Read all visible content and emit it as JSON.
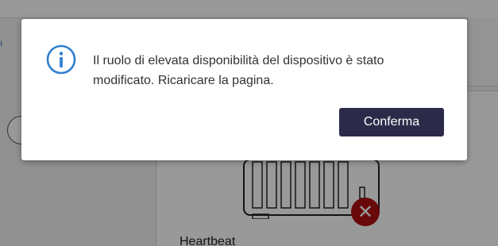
{
  "dialog": {
    "icon": "info-icon",
    "message": "Il ruolo di elevata disponibilità del dispositivo è stato modificato. Ricaricare la pagina.",
    "confirm_label": "Conferma"
  },
  "background": {
    "device_label": "Heartbeat",
    "error_icon": "close-icon"
  },
  "colors": {
    "info_blue": "#2f7fd0",
    "confirm_button": "#2b2a49",
    "error_badge": "#b01010"
  }
}
